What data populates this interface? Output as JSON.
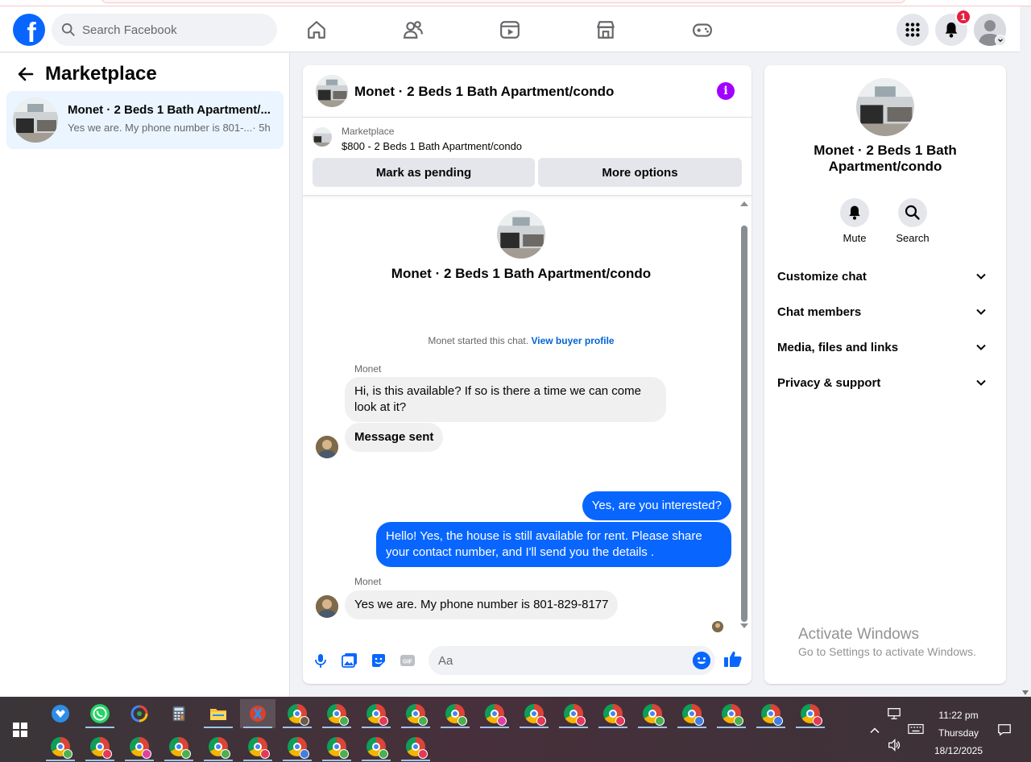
{
  "nav": {
    "logo": "f",
    "search_placeholder": "Search Facebook",
    "notification_count": "1"
  },
  "sidebar": {
    "title": "Marketplace",
    "conversations": [
      {
        "title": "Monet · 2 Beds 1 Bath Apartment/...",
        "preview": "Yes we are. My phone number is 801-...",
        "time": "· 5h"
      }
    ]
  },
  "chat": {
    "title": "Monet · 2 Beds 1 Bath Apartment/condo",
    "info_glyph": "i",
    "listing": {
      "source": "Marketplace",
      "description": "$800 - 2 Beds 1 Bath Apartment/condo",
      "mark_pending_label": "Mark as pending",
      "more_options_label": "More options"
    },
    "intro_title": "Monet · 2 Beds 1 Bath Apartment/condo",
    "started_text": "Monet started this chat.",
    "view_profile_link": "View buyer profile",
    "messages": [
      {
        "sender": "Monet",
        "direction": "in",
        "text": "Hi, is this available? If so is there a time we can come look at it?"
      },
      {
        "direction": "in",
        "text": "Message sent"
      },
      {
        "direction": "out",
        "text": "Yes, are you interested?"
      },
      {
        "direction": "out",
        "text": "Hello! Yes, the house is still available for rent. Please share your contact number, and I'll send you the details ."
      },
      {
        "sender": "Monet",
        "direction": "in",
        "text": "Yes we are. My phone number is 801-829-8177"
      }
    ],
    "composer_placeholder": "Aa",
    "gif_label": "GIF"
  },
  "info_panel": {
    "name": "Monet · 2 Beds 1 Bath Apartment/condo",
    "actions": [
      {
        "label": "Mute",
        "icon": "bell-icon"
      },
      {
        "label": "Search",
        "icon": "search-icon"
      }
    ],
    "sections": [
      "Customize chat",
      "Chat members",
      "Media, files and links",
      "Privacy & support"
    ]
  },
  "watermark": {
    "line1": "Activate Windows",
    "line2": "Go to Settings to activate Windows."
  },
  "taskbar": {
    "time": "11:22 pm",
    "day": "Thursday",
    "date": "18/12/2025"
  },
  "colors": {
    "facebook_blue": "#0866ff",
    "info_purple": "#a100ff",
    "badge_red": "#e41e3f",
    "selected_bg": "#ebf5ff"
  }
}
